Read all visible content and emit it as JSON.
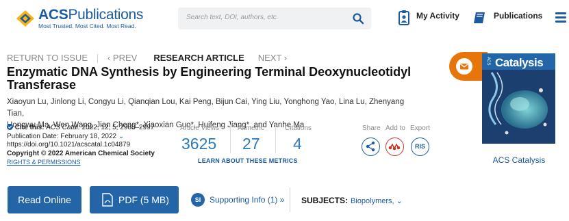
{
  "header": {
    "logo_brand": "ACS",
    "logo_name": "Publications",
    "logo_tagline": "Most Trusted. Most Cited. Most Read.",
    "search_placeholder": "Search text, DOI, authors, etc.",
    "my_activity": "My Activity",
    "publications": "Publications"
  },
  "breadcrumb": {
    "return": "RETURN TO ISSUE",
    "prev": "‹ PREV",
    "type": "RESEARCH ARTICLE",
    "next": "NEXT ›"
  },
  "article": {
    "title": "Enzymatic DNA Synthesis by Engineering Terminal Deoxynucleotidyl Transferase",
    "authors_line1": "Xiaoyun Lu, Jinlong Li, Congyu Li, Qianqian Lou, Kai Peng, Bijun Cai, Ying Liu, Yonghong Yao, Lina Lu, Zhenyang Tian,",
    "authors_line2": "Hongwu Ma, Wen Wang, Jian Cheng*, Xiaoxian Guo*, Huifeng Jiang*, and Yanhe Ma"
  },
  "cite": {
    "label": "Cite this:",
    "journal": "ACS Catal.",
    "ref": " 2022, 12, 5, 2988–2997",
    "pub_date": "Publication Date: February 18, 2022",
    "doi": "https://doi.org/10.1021/acscatal.1c04879",
    "copyright": "Copyright © 2022 American Chemical Society",
    "rights": "RIGHTS & PERMISSIONS"
  },
  "metrics": {
    "views_label": "Article Views",
    "views": "3625",
    "altmetric_label": "Altmetric",
    "altmetric": "27",
    "citations_label": "Citations",
    "citations": "4",
    "learn": "LEARN ABOUT THESE METRICS"
  },
  "actions": {
    "share": "Share",
    "add_to": "Add to",
    "export": "Export",
    "ris": "RIS"
  },
  "cover": {
    "journal": "Catalysis",
    "acs": "ACS",
    "caption": "ACS Catalysis"
  },
  "buttons": {
    "read_online": "Read Online",
    "pdf": "PDF (5 MB)",
    "si_badge": "SI",
    "supporting_info": "Supporting Info (1) »",
    "subjects_label": "SUBJECTS:",
    "subjects_value": "Biopolymers, ⌄"
  },
  "colors": {
    "brand_blue": "#1a5a9e",
    "button_blue": "#2465a8",
    "accent_orange": "#e8750a"
  }
}
